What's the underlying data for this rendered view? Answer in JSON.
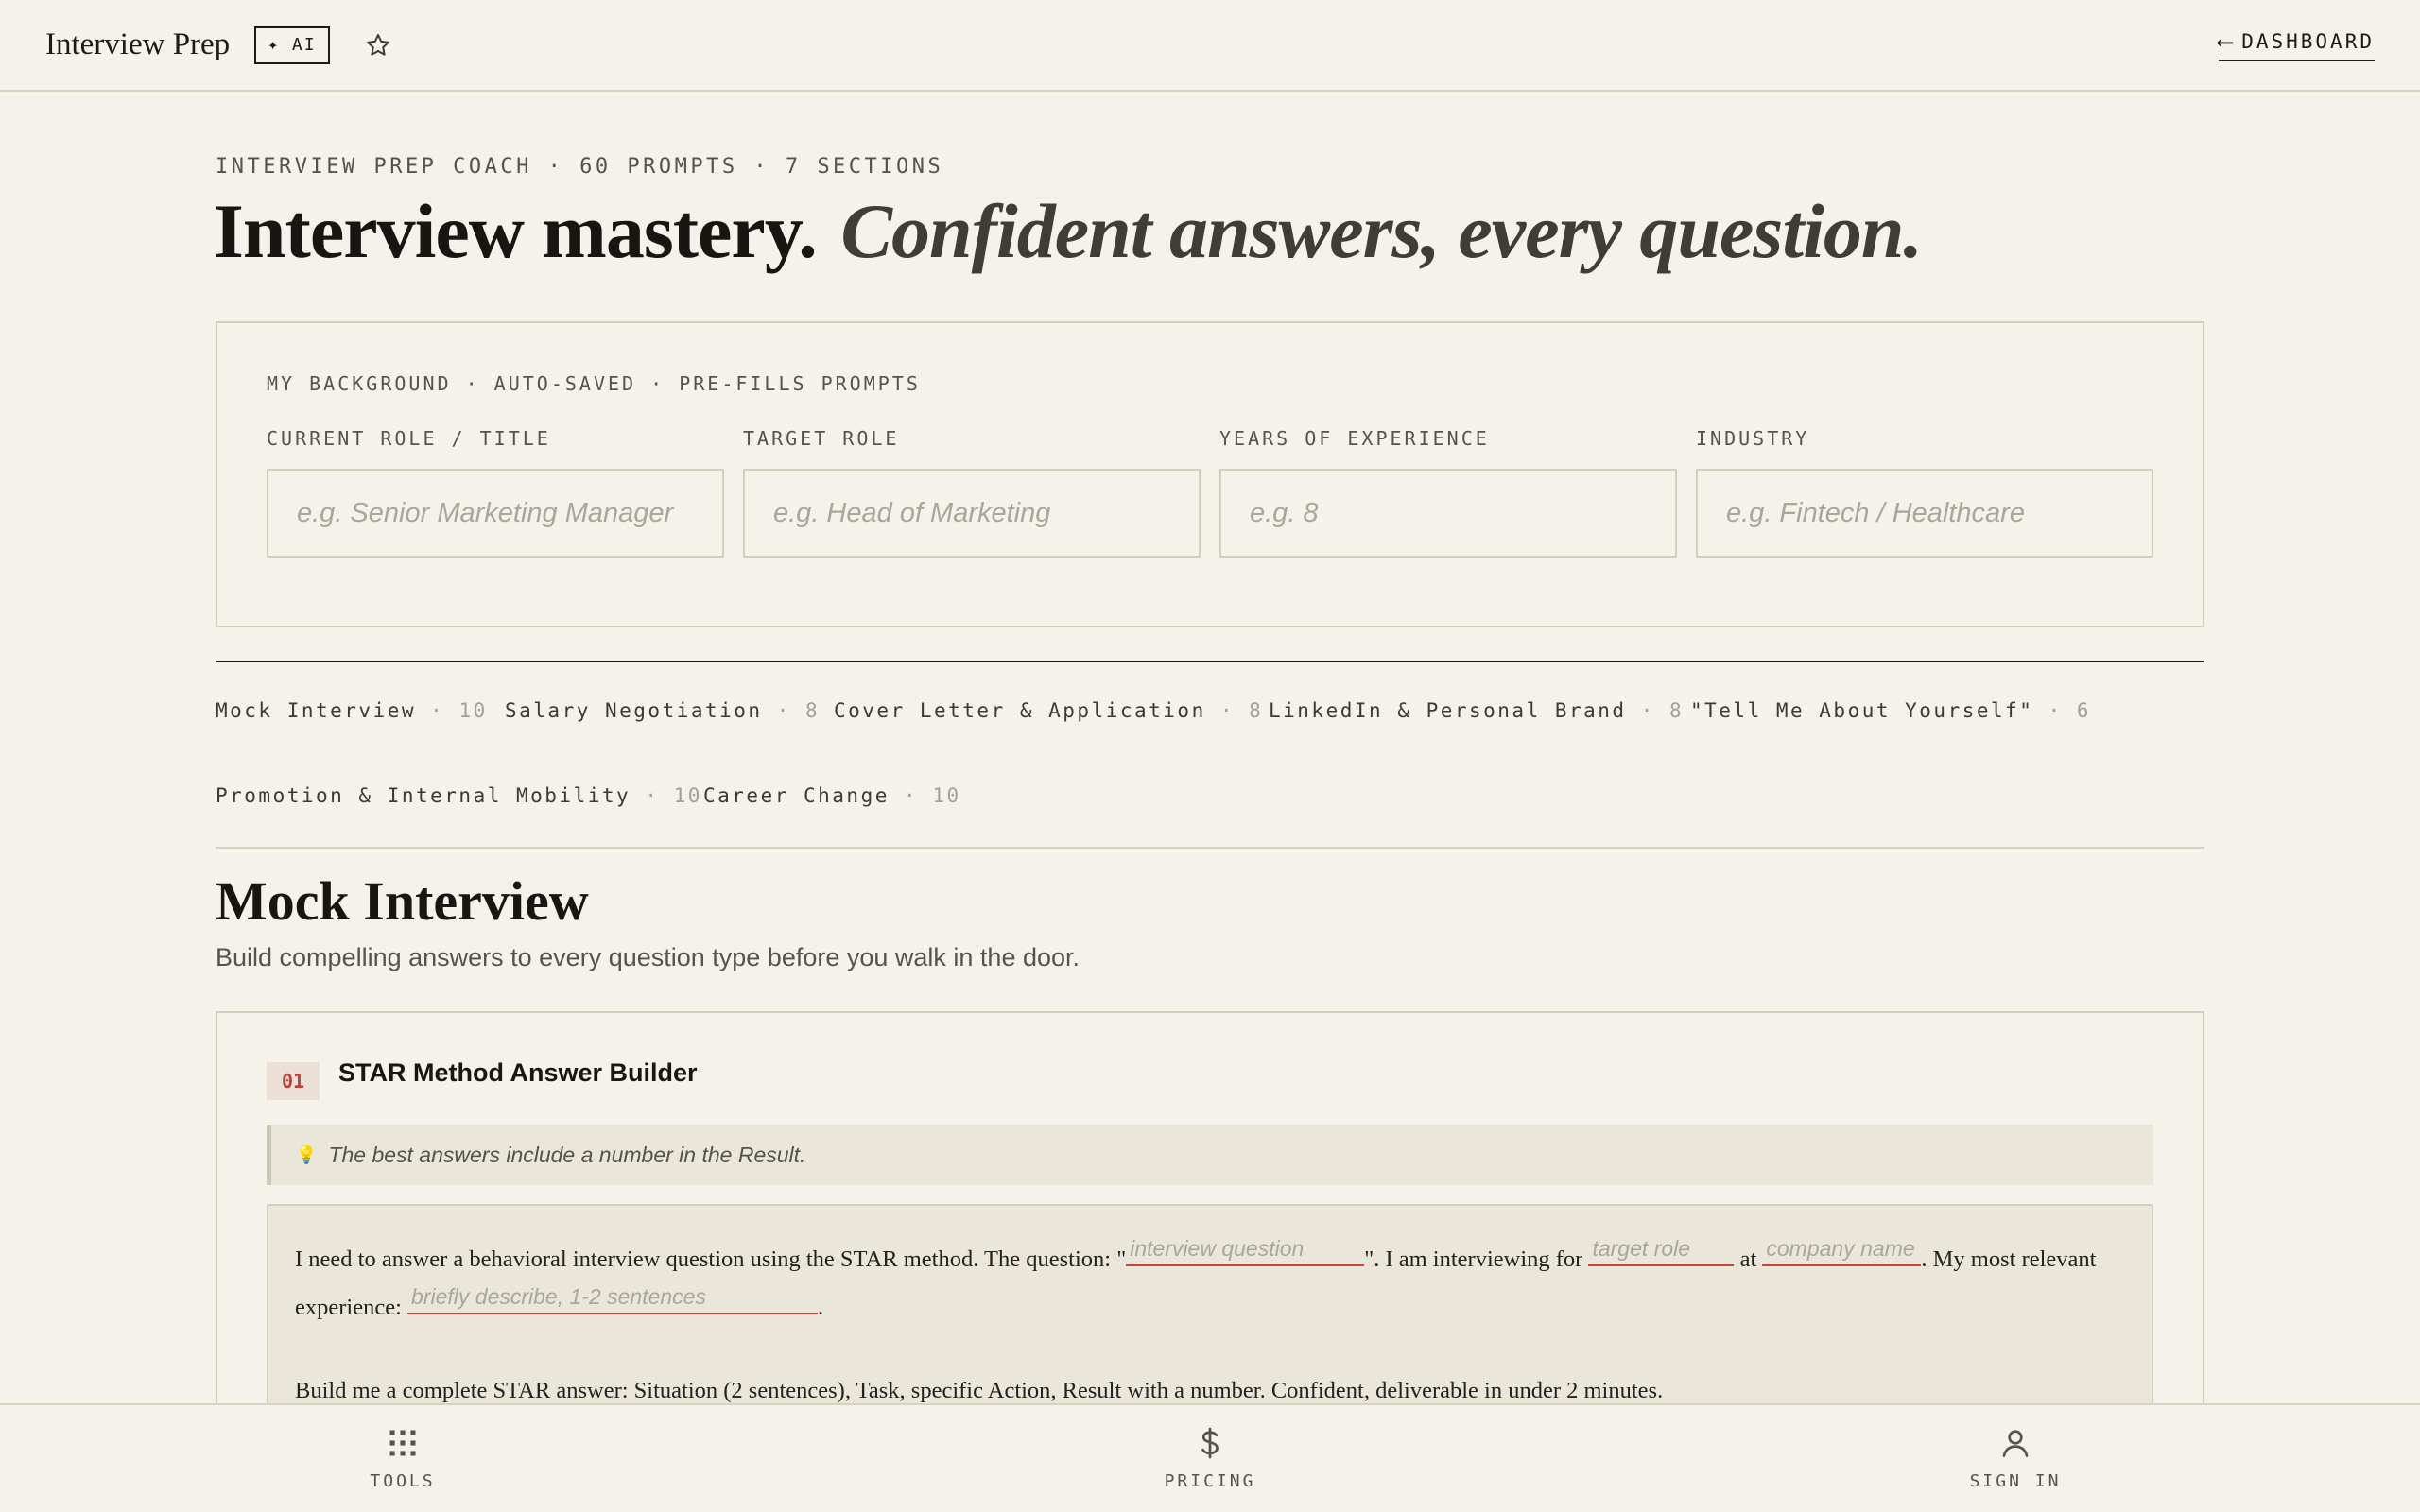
{
  "topbar": {
    "brand": "Interview Prep",
    "ai_badge": "✦ AI",
    "dashboard_arrow": "⟵",
    "dashboard_label": "DASHBOARD"
  },
  "header": {
    "eyebrow": "INTERVIEW PREP COACH · 60 PROMPTS · 7 SECTIONS",
    "headline_main": "Interview mastery.",
    "headline_italic": "Confident answers, every question."
  },
  "background": {
    "label": "MY BACKGROUND · AUTO-SAVED · PRE-FILLS PROMPTS",
    "fields": [
      {
        "label": "CURRENT ROLE / TITLE",
        "placeholder": "e.g. Senior Marketing Manager",
        "value": ""
      },
      {
        "label": "TARGET ROLE",
        "placeholder": "e.g. Head of Marketing",
        "value": ""
      },
      {
        "label": "YEARS OF EXPERIENCE",
        "placeholder": "e.g. 8",
        "value": ""
      },
      {
        "label": "INDUSTRY",
        "placeholder": "e.g. Fintech / Healthcare",
        "value": ""
      }
    ]
  },
  "tabs": [
    {
      "label": "Mock Interview",
      "count": "· 10"
    },
    {
      "label": "Salary Negotiation",
      "count": "· 8"
    },
    {
      "label": "Cover Letter & Application",
      "count": "· 8"
    },
    {
      "label": "LinkedIn & Personal Brand",
      "count": "· 8"
    },
    {
      "label": "\"Tell Me About Yourself\"",
      "count": "· 6"
    },
    {
      "label": "Promotion & Internal Mobility",
      "count": "· 10"
    },
    {
      "label": "Career Change",
      "count": "· 10"
    }
  ],
  "section": {
    "title": "Mock Interview",
    "description": "Build compelling answers to every question type before you walk in the door."
  },
  "prompt": {
    "number": "01",
    "title": "STAR Method Answer Builder",
    "tip_icon": "💡",
    "tip": "The best answers include a number in the Result.",
    "text_1": "I need to answer a behavioral interview question using the STAR method. The question: \"",
    "blank_question": "interview question",
    "text_2": "\". I am interviewing for",
    "blank_role": "target role",
    "text_3": "at",
    "blank_company": "company name",
    "text_4": ". My most relevant experience:",
    "blank_experience": "briefly describe, 1-2 sentences",
    "text_5": ".",
    "paragraph_2": "Build me a complete STAR answer: Situation (2 sentences), Task, specific Action, Result with a number. Confident, deliverable in under 2 minutes."
  },
  "bottom_nav": {
    "tools": "TOOLS",
    "pricing": "PRICING",
    "sign_in": "SIGN IN"
  },
  "colors": {
    "background": "#f4f2ea",
    "accent_red": "#c9453a",
    "border": "#d2cfbd"
  }
}
